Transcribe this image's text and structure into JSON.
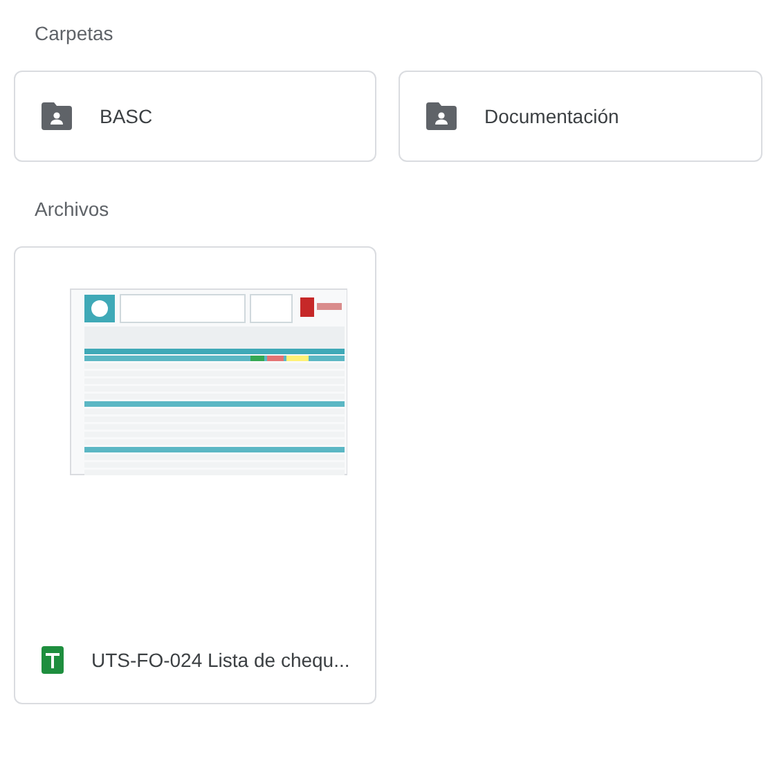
{
  "sections": [
    {
      "kind": "folders",
      "title": "Carpetas",
      "items": [
        {
          "name": "BASC"
        },
        {
          "name": "Documentación"
        }
      ]
    },
    {
      "kind": "files",
      "title": "Archivos",
      "items": [
        {
          "name": "UTS-FO-024 Lista de chequ..."
        }
      ]
    }
  ]
}
